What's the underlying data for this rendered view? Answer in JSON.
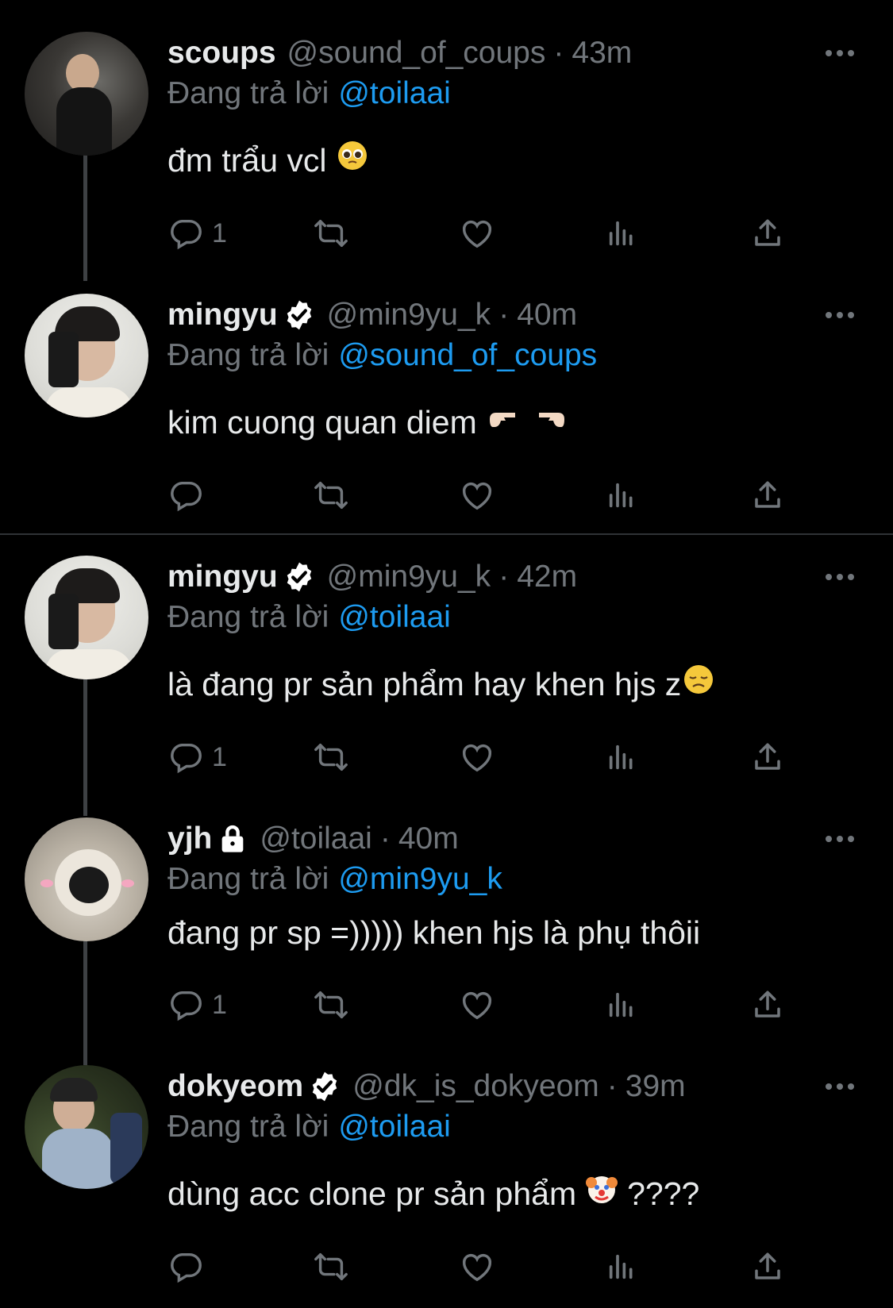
{
  "colors": {
    "background": "#000000",
    "text": "#e7e9ea",
    "muted": "#71767b",
    "link": "#1d9bf0"
  },
  "tweets": [
    {
      "name": "scoups",
      "handle": "@sound_of_coups",
      "time": "43m",
      "reply_prefix": "Đang trả lời",
      "reply_to": "@toilaai",
      "text": "đm trẩu vcl",
      "emoji": "pleading-face-emoji",
      "reply_count": "1",
      "badge": "none"
    },
    {
      "name": "mingyu",
      "handle": "@min9yu_k",
      "time": "40m",
      "reply_prefix": "Đang trả lời",
      "reply_to": "@sound_of_coups",
      "text": "kim cuong quan diem",
      "emoji": "pointing-hands-emoji",
      "reply_count": "",
      "badge": "verified"
    },
    {
      "name": "mingyu",
      "handle": "@min9yu_k",
      "time": "42m",
      "reply_prefix": "Đang trả lời",
      "reply_to": "@toilaai",
      "text": "là đang pr sản phẩm hay khen hjs z",
      "emoji": "disappointed-face-emoji",
      "reply_count": "1",
      "badge": "verified"
    },
    {
      "name": "yjh",
      "handle": "@toilaai",
      "time": "40m",
      "reply_prefix": "Đang trả lời",
      "reply_to": "@min9yu_k",
      "text": "đang pr sp =))))) khen hjs là phụ thôii",
      "emoji": "",
      "reply_count": "1",
      "badge": "lock"
    },
    {
      "name": "dokyeom",
      "handle": "@dk_is_dokyeom",
      "time": "39m",
      "reply_prefix": "Đang trả lời",
      "reply_to": "@toilaai",
      "text": "dùng acc clone pr sản phẩm",
      "text_suffix": "????",
      "emoji": "clown-face-emoji",
      "reply_count": "",
      "badge": "verified"
    }
  ],
  "dot_separator": "·"
}
